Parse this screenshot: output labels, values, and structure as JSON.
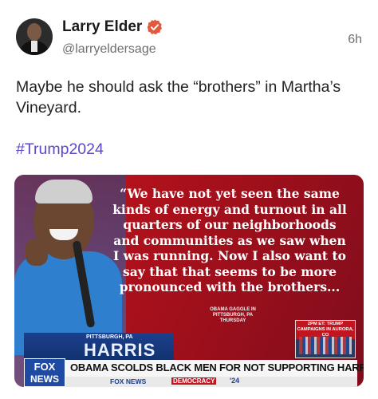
{
  "post": {
    "author_name": "Larry Elder",
    "handle": "@larryeldersage",
    "time": "6h",
    "text": "Maybe he should ask the “brothers” in Martha’s Vineyard.",
    "hashtag": "#Trump2024"
  },
  "media": {
    "quote": "“We have not yet seen the same kinds of energy and turnout in all quarters of our neighborhoods and communities as we saw when I was running. Now I also want to say that that seems to be more pronounced with the brothers...",
    "quote_credit_line1": "OBAMA GAGGLE IN PITTSBURGH, PA",
    "quote_credit_line2": "THURSDAY",
    "location_label": "PITTSBURGH, PA",
    "location_big": "HARRIS",
    "inset_label": "2PM ET: TRUMP CAMPAIGNS IN AURORA, CO",
    "network_logo_top": "FOX",
    "network_logo_bottom": "NEWS",
    "headline": "OBAMA SCOLDS BLACK MEN FOR NOT SUPPORTING HARRIS",
    "ticker_brand": "FOX NEWS",
    "ticker_badge": "DEMOCRACY",
    "ticker_num": "'24"
  },
  "colors": {
    "hashtag": "#5a49c7",
    "verified_badge": "#e25a3d",
    "fox_red": "#c1161f",
    "fox_blue": "#1f4aa3"
  },
  "icons": {
    "verified": "verified-badge-icon"
  }
}
